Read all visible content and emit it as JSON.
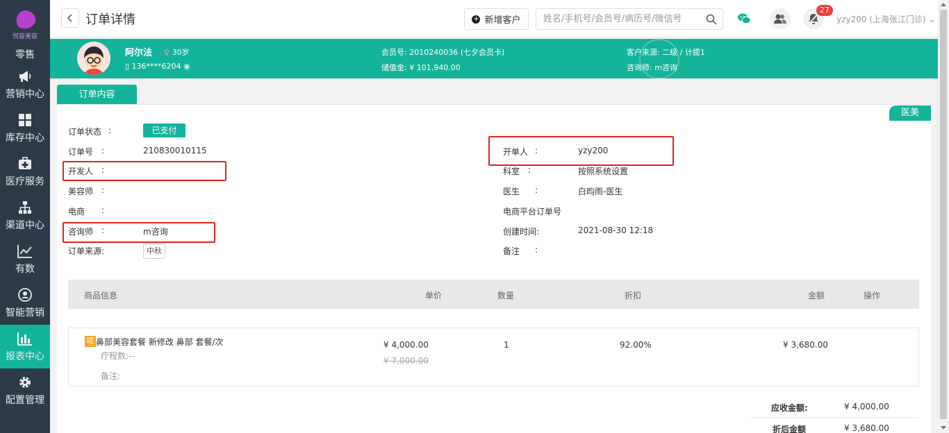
{
  "app": {
    "logo_text": "悦容美容",
    "page_title": "订单详情"
  },
  "sidebar": {
    "items": [
      {
        "label": "零售",
        "icon": "retail-icon"
      },
      {
        "label": "营销中心",
        "icon": "megaphone-icon"
      },
      {
        "label": "库存中心",
        "icon": "grid-icon"
      },
      {
        "label": "医疗服务",
        "icon": "medical-kit-icon"
      },
      {
        "label": "渠道中心",
        "icon": "org-chart-icon"
      },
      {
        "label": "有数",
        "icon": "line-chart-icon"
      },
      {
        "label": "智能营销",
        "icon": "smart-marketing-icon"
      },
      {
        "label": "报表中心",
        "icon": "bar-chart-icon"
      },
      {
        "label": "配置管理",
        "icon": "gear-icon"
      }
    ],
    "active_index": 7
  },
  "topbar": {
    "add_customer_label": "新增客户",
    "search_placeholder": "姓名/手机号/会员号/病历号/微信号",
    "notification_count": "27",
    "user_label": "yzy200 (上海张江门诊)"
  },
  "customer": {
    "name": "阿尔法",
    "age": "30岁",
    "phone": "136****6204",
    "member_no_label": "会员号:",
    "member_no": "2010240036 (七夕会员卡)",
    "stored_value_label": "储值金:",
    "stored_value": "¥ 101,940.00",
    "source_label": "客户来源:",
    "source": "二级 / 计提1",
    "consultant_label": "咨询师:",
    "consultant": "m咨询"
  },
  "tabs": {
    "order_content": "订单内容"
  },
  "order": {
    "category_tag": "医美",
    "left_fields": [
      {
        "label": "订单状态",
        "value": "已支付"
      },
      {
        "label": "订单号",
        "value": "210830010115"
      },
      {
        "label": "开发人",
        "value": ""
      },
      {
        "label": "美容师",
        "value": ""
      },
      {
        "label": "电商",
        "value": ""
      },
      {
        "label": "咨询师",
        "value": "m咨询"
      },
      {
        "label": "订单来源:",
        "value": "中秋"
      }
    ],
    "right_fields": [
      {
        "label": "开单人",
        "value": "yzy200"
      },
      {
        "label": "科室",
        "value": "按照系统设置"
      },
      {
        "label": "医生",
        "value": "白昀雨-医生"
      },
      {
        "label": "电商平台订单号",
        "value": ""
      },
      {
        "label": "创建时间:",
        "value": "2021-08-30 12:18"
      },
      {
        "label": "备注",
        "value": ""
      }
    ],
    "colon": ":"
  },
  "table": {
    "headers": [
      "商品信息",
      "单价",
      "数量",
      "折扣",
      "金额",
      "操作"
    ],
    "rows": [
      {
        "tag": "项",
        "name": "鼻部美容套餐 新修改   鼻部   套餐/次",
        "course": "疗程数:--",
        "note": "备注:",
        "unit_price": "¥ 4,000.00",
        "original_price": "¥ 7,000.00",
        "quantity": "1",
        "discount": "92.00%",
        "amount": "¥ 3,680.00"
      }
    ]
  },
  "summary": {
    "receivable_label": "应收金额:",
    "receivable": "¥ 4,000.00",
    "discounted_label": "折后金额",
    "discounted": "¥ 3,680.00"
  },
  "colors": {
    "sidebar_bg": "#2d3a48",
    "accent": "#14b39b",
    "highlight_box": "#e02020",
    "badge": "#f23a3a"
  }
}
